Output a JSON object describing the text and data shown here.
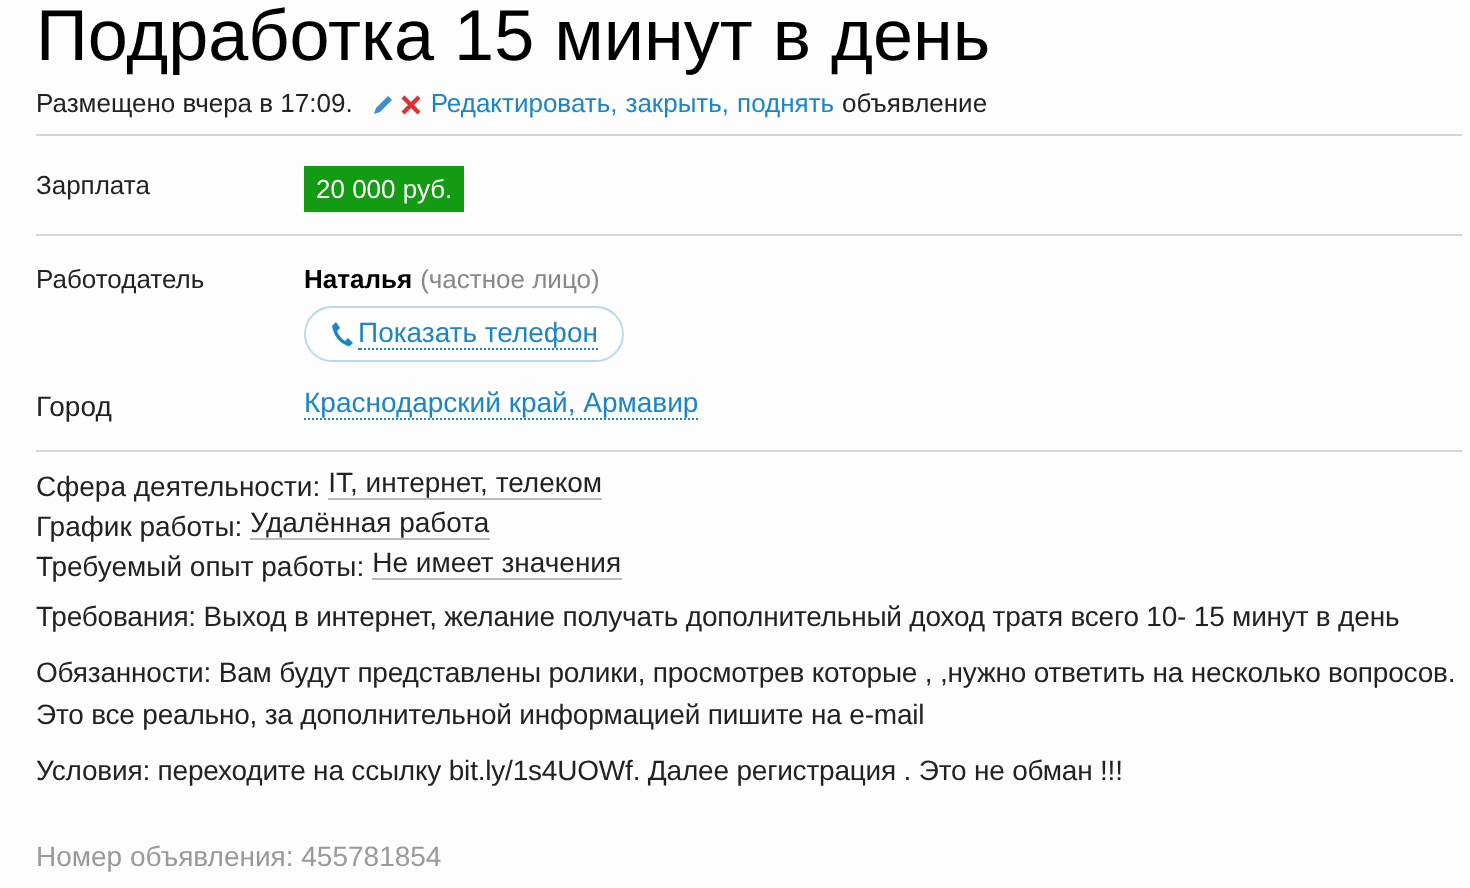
{
  "title": "Подработка 15 минут в день",
  "meta": {
    "posted": "Размещено вчера в 17:09.",
    "links": [
      "Редактировать,",
      "закрыть,",
      "поднять"
    ],
    "suffix": "объявление"
  },
  "salary": {
    "label": "Зарплата",
    "value": "20 000 руб."
  },
  "employer": {
    "label": "Работодатель",
    "name": "Наталья",
    "type": "(частное лицо)",
    "phone_button": "Показать телефон"
  },
  "city": {
    "label": "Город",
    "value": "Краснодарский край, Армавир"
  },
  "attributes": [
    {
      "label": "Сфера деятельности:",
      "value": "IT, интернет, телеком"
    },
    {
      "label": "График работы:",
      "value": "Удалённая работа"
    },
    {
      "label": "Требуемый опыт работы:",
      "value": "Не имеет значения"
    }
  ],
  "paragraphs": [
    "Требования: Выход в интернет, желание получать дополнительный доход тратя всего 10- 15 минут в день",
    "Обязанности: Вам будут представлены ролики, просмотрев которые , ,нужно ответить на несколько вопросов. Это все реально, за дополнительной информацией пишите на e-mail",
    "Условия: переходите на ссылку bit.ly/1s4UOWf. Далее регистрация . Это не обман !!!"
  ],
  "ad_number": "Номер объявления: 455781854"
}
